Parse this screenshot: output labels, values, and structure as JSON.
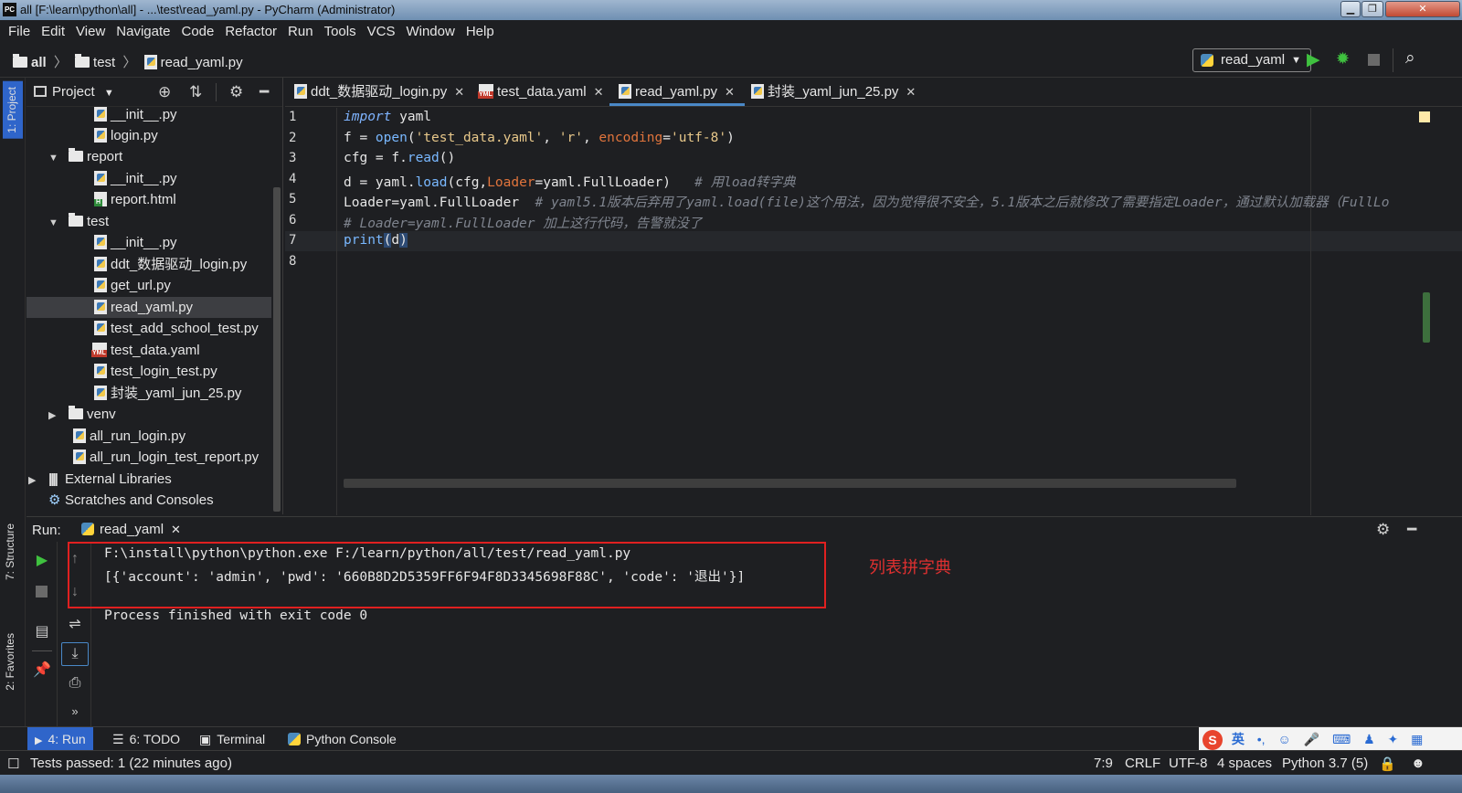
{
  "window": {
    "title": "all [F:\\learn\\python\\all] - ...\\test\\read_yaml.py - PyCharm (Administrator)",
    "app_icon": "PC"
  },
  "menu": [
    "File",
    "Edit",
    "View",
    "Navigate",
    "Code",
    "Refactor",
    "Run",
    "Tools",
    "VCS",
    "Window",
    "Help"
  ],
  "breadcrumb": {
    "root": "all",
    "folder": "test",
    "file": "read_yaml.py"
  },
  "run_config": {
    "name": "read_yaml"
  },
  "left_strip": {
    "project": "1: Project",
    "structure": "7: Structure",
    "favorites": "2: Favorites"
  },
  "project_panel": {
    "title": "Project",
    "items": [
      {
        "label": "__init__.py",
        "type": "py"
      },
      {
        "label": "login.py",
        "type": "py"
      },
      {
        "label": "report",
        "type": "folder"
      },
      {
        "label": "__init__.py",
        "type": "py"
      },
      {
        "label": "report.html",
        "type": "html"
      },
      {
        "label": "test",
        "type": "folder"
      },
      {
        "label": "__init__.py",
        "type": "py"
      },
      {
        "label": "ddt_数据驱动_login.py",
        "type": "py"
      },
      {
        "label": "get_url.py",
        "type": "py"
      },
      {
        "label": "read_yaml.py",
        "type": "py",
        "selected": true
      },
      {
        "label": "test_add_school_test.py",
        "type": "py"
      },
      {
        "label": "test_data.yaml",
        "type": "yml"
      },
      {
        "label": "test_login_test.py",
        "type": "py"
      },
      {
        "label": "封装_yaml_jun_25.py",
        "type": "py"
      },
      {
        "label": "venv",
        "type": "folder"
      },
      {
        "label": "all_run_login.py",
        "type": "py"
      },
      {
        "label": "all_run_login_test_report.py",
        "type": "py"
      },
      {
        "label": "External Libraries",
        "type": "lib"
      },
      {
        "label": "Scratches and Consoles",
        "type": "scratch"
      }
    ]
  },
  "editor_tabs": [
    {
      "label": "ddt_数据驱动_login.py",
      "type": "py"
    },
    {
      "label": "test_data.yaml",
      "type": "yml"
    },
    {
      "label": "read_yaml.py",
      "type": "py",
      "active": true
    },
    {
      "label": "封装_yaml_jun_25.py",
      "type": "py"
    }
  ],
  "code": {
    "line_numbers": [
      "1",
      "2",
      "3",
      "4",
      "5",
      "6",
      "7",
      "8"
    ],
    "l1": {
      "kw": "import",
      "rest": " yaml"
    },
    "l2": {
      "a": "f = ",
      "fn": "open",
      "b": "(",
      "s1": "'test_data.yaml'",
      "c": ", ",
      "s2": "'r'",
      "d": ", ",
      "p": "encoding",
      "e": "=",
      "s3": "'utf-8'",
      "f": ")"
    },
    "l3": {
      "a": "cfg = f.",
      "fn": "read",
      "b": "()"
    },
    "l4": {
      "a": "d = yaml.",
      "fn": "load",
      "b": "(cfg,",
      "p": "Loader",
      "c": "=yaml.FullLoader)   ",
      "cm": "# 用load转字典"
    },
    "l5": {
      "a": "Loader=yaml.FullLoader  ",
      "cm": "# yaml5.1版本后弃用了yaml.load(file)这个用法，因为觉得很不安全，5.1版本之后就修改了需要指定Loader，通过默认加载器（FullLo"
    },
    "l6": {
      "cm": "# Loader=yaml.FullLoader 加上这行代码，告警就没了"
    },
    "l7": {
      "fn": "print",
      "b": "(",
      "v": "d",
      "c": ")"
    }
  },
  "run_panel": {
    "label": "Run:",
    "tab": "read_yaml",
    "output": [
      "F:\\install\\python\\python.exe F:/learn/python/all/test/read_yaml.py",
      "[{'account': 'admin', 'pwd': '660B8D2D5359FF6F94F8D3345698F88C', 'code': '退出'}]",
      "Process finished with exit code 0"
    ],
    "annotation": "列表拼字典",
    "highlight_color": "#e02020"
  },
  "bottom_tabs": [
    {
      "label": "4: Run",
      "active": true
    },
    {
      "label": "6: TODO"
    },
    {
      "label": "Terminal"
    },
    {
      "label": "Python Console"
    }
  ],
  "ime": {
    "lang": "英"
  },
  "status": {
    "tests": "Tests passed: 1 (22 minutes ago)",
    "position": "7:9",
    "line_sep": "CRLF",
    "encoding": "UTF-8",
    "indent": "4 spaces",
    "interpreter": "Python 3.7 (5)"
  },
  "colors": {
    "accent": "#2f65ca",
    "run_green": "#3fc13f",
    "keyword": "#7fb4ff",
    "string": "#e8c88a",
    "param": "#e0743c",
    "comment": "#7f848e"
  }
}
